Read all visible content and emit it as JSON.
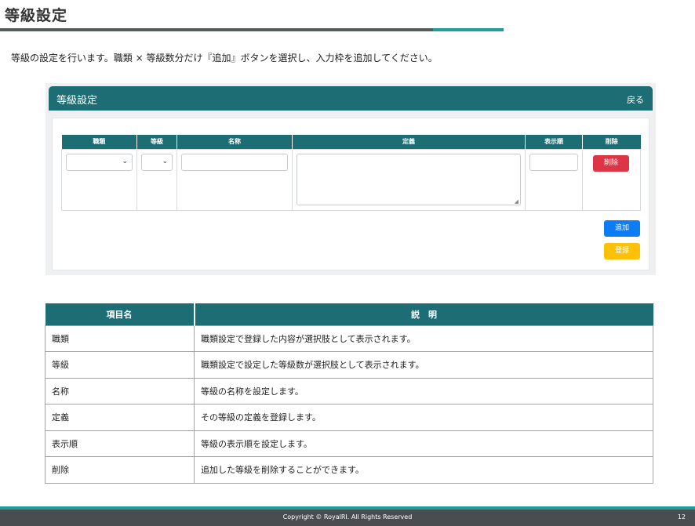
{
  "page": {
    "title": "等級設定",
    "intro": "等級の設定を行います。職類 × 等級数分だけ『追加』ボタンを選択し、入力枠を追加してください。"
  },
  "panel": {
    "title": "等級設定",
    "back_label": "戻る",
    "columns": [
      "職類",
      "等級",
      "名称",
      "定義",
      "表示順",
      "削除"
    ],
    "row": {
      "job_type_value": "",
      "grade_value": "",
      "name_value": "",
      "definition_value": "",
      "display_order_value": ""
    },
    "delete_label": "削除",
    "add_label": "追加",
    "register_label": "登録"
  },
  "description_table": {
    "headers": [
      "項目名",
      "説　明"
    ],
    "rows": [
      {
        "item": "職類",
        "desc": "職類設定で登録した内容が選択肢として表示されます。"
      },
      {
        "item": "等級",
        "desc": "職類設定で設定した等級数が選択肢として表示されます。"
      },
      {
        "item": "名称",
        "desc": "等級の名称を設定します。"
      },
      {
        "item": "定義",
        "desc": "その等級の定義を登録します。"
      },
      {
        "item": "表示順",
        "desc": "等級の表示順を設定します。"
      },
      {
        "item": "削除",
        "desc": "追加した等級を削除することができます。"
      }
    ]
  },
  "footer": {
    "copyright": "Copyright © RoyalRI. All Rights Reserved",
    "page_number": "12"
  },
  "colors": {
    "header_teal": "#1c6e74",
    "accent_teal": "#1d9e9a",
    "delete_red": "#dc3545",
    "add_blue": "#0d7cf7",
    "register_yellow": "#ffc107"
  },
  "icons": {
    "select_arrow": "chevron-down-icon",
    "textarea_grip": "resize-grip-icon"
  }
}
